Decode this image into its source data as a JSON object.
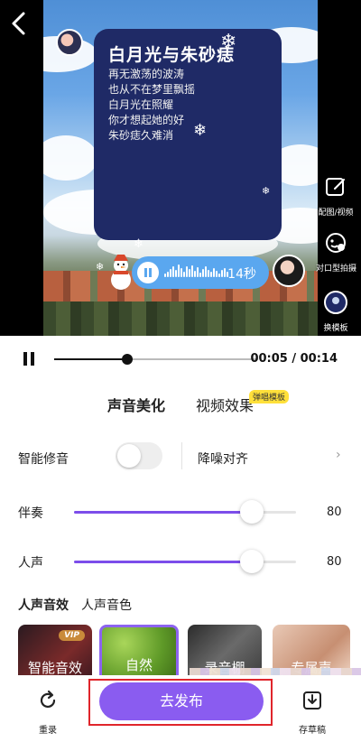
{
  "app": {
    "accent_color": "#8a5cf0",
    "highlight_color": "#ffe03a",
    "card_color": "#1f2a66"
  },
  "video": {
    "back_icon": "chevron-left-icon",
    "lyric_card": {
      "title": "白月光与朱砂痣",
      "lines": [
        "再无激荡的波涛",
        "也从不在梦里飘摇",
        "白月光在照耀",
        "你才想起她的好",
        "朱砂痣久难消"
      ]
    },
    "side_tools": [
      {
        "label": "配图/视频",
        "icon": "edit-image-icon"
      },
      {
        "label": "对口型拍摄",
        "icon": "face-sync-icon"
      },
      {
        "label": "换模板",
        "icon": "template-icon"
      }
    ],
    "audio_pill": {
      "duration": "14秒",
      "icon": "pause-icon"
    }
  },
  "playback": {
    "time": "00:05 / 00:14",
    "progress": 0.36
  },
  "panel": {
    "tabs": [
      {
        "label": "声音美化",
        "active": true
      },
      {
        "label": "视频效果",
        "active": false
      }
    ],
    "tab_badge": "弹唱模板",
    "smart_tune": {
      "label": "智能修音",
      "enabled": false
    },
    "denoise": {
      "label": "降噪对齐",
      "icon": "chevron-right-icon"
    },
    "accompaniment": {
      "label": "伴奏",
      "value": "80",
      "level": 0.8
    },
    "vocal": {
      "label": "人声",
      "value": "80",
      "level": 0.8
    },
    "subtabs": [
      {
        "label": "人声音效",
        "active": true
      },
      {
        "label": "人声音色",
        "active": false
      }
    ],
    "effects": [
      {
        "name": "智能音效",
        "vip": "VIP",
        "selected": false
      },
      {
        "name": "自然",
        "selected": true
      },
      {
        "name": "录音棚",
        "selected": false
      },
      {
        "name": "专属声",
        "selected": false
      }
    ]
  },
  "bottom": {
    "rerecord": {
      "label": "重录",
      "icon": "refresh-icon"
    },
    "publish": {
      "label": "去发布"
    },
    "save_draft": {
      "label": "存草稿",
      "icon": "save-draft-icon"
    }
  }
}
